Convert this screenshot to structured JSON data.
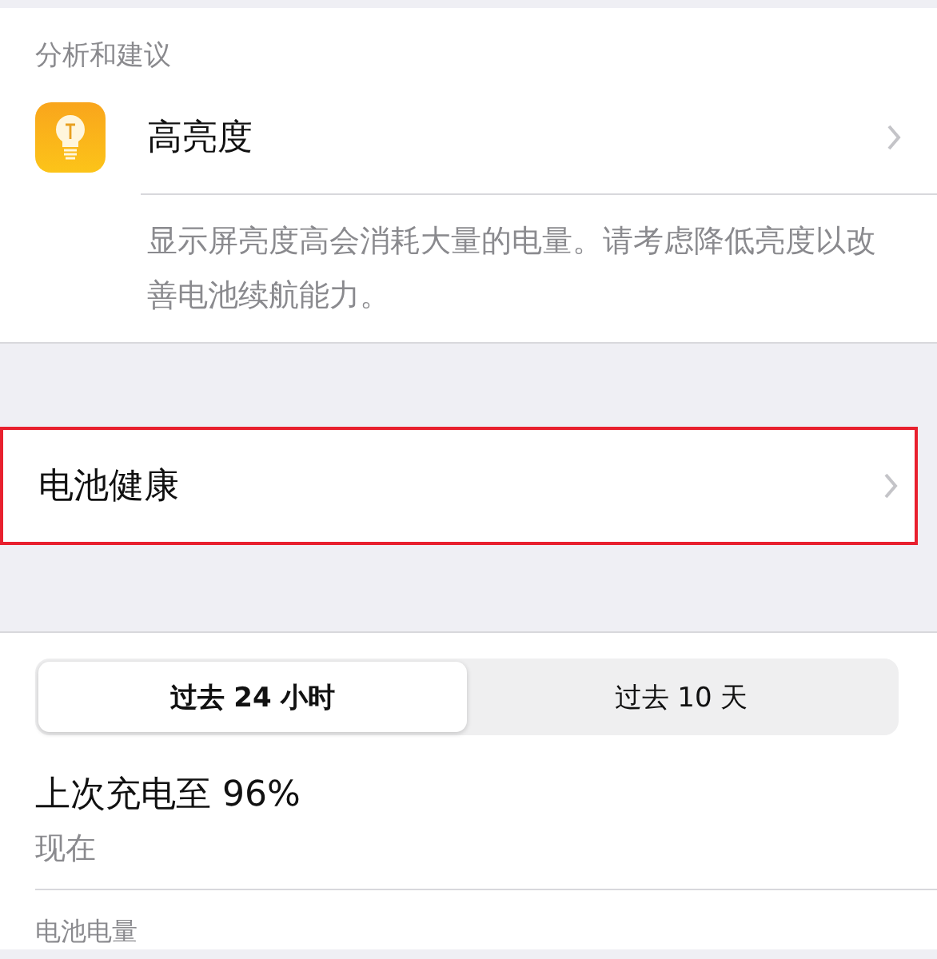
{
  "suggestions": {
    "header": "分析和建议",
    "item": {
      "title": "高亮度",
      "description": "显示屏亮度高会消耗大量的电量。请考虑降低亮度以改善电池续航能力。"
    }
  },
  "battery_health": {
    "label": "电池健康",
    "highlighted": true
  },
  "segments": [
    {
      "label": "过去 24 小时",
      "selected": true
    },
    {
      "label": "过去 10 天",
      "selected": false
    }
  ],
  "last_charge": {
    "title": "上次充电至 96%",
    "time": "现在"
  },
  "battery_level_header": "电池电量"
}
